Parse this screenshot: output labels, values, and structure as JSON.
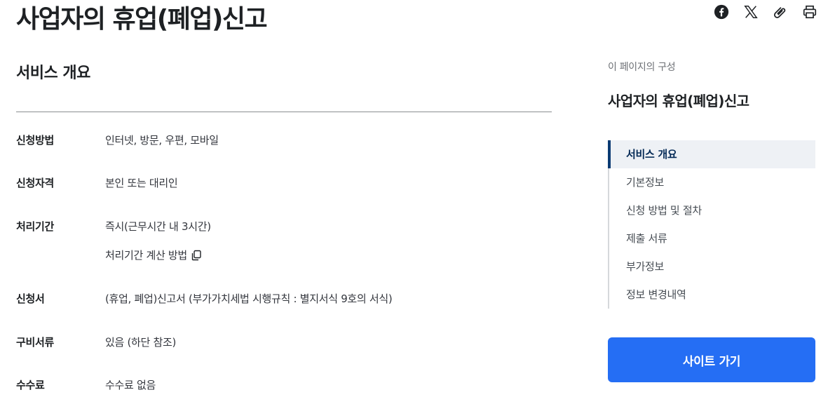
{
  "page": {
    "title": "사업자의 휴업(폐업)신고"
  },
  "share": {
    "icons": [
      "facebook-icon",
      "x-twitter-icon",
      "paperclip-icon",
      "printer-icon"
    ]
  },
  "overview": {
    "heading": "서비스 개요",
    "rows": [
      {
        "label": "신청방법",
        "value": "인터넷, 방문, 우편, 모바일"
      },
      {
        "label": "신청자격",
        "value": "본인 또는 대리인"
      },
      {
        "label": "처리기간",
        "value": "즉시(근무시간 내 3시간)",
        "link": "처리기간 계산 방법"
      },
      {
        "label": "신청서",
        "value": "(휴업, 폐업)신고서 (부가가치세법 시행규칙 : 별지서식 9호의 서식)"
      },
      {
        "label": "구비서류",
        "value": "있음 (하단 참조)"
      },
      {
        "label": "수수료",
        "value": "수수료 없음"
      }
    ]
  },
  "toc": {
    "caption": "이 페이지의 구성",
    "title": "사업자의 휴업(폐업)신고",
    "items": [
      {
        "label": "서비스 개요",
        "active": true
      },
      {
        "label": "기본정보"
      },
      {
        "label": "신청 방법 및 절차"
      },
      {
        "label": "제출 서류"
      },
      {
        "label": "부가정보"
      },
      {
        "label": "정보 변경내역"
      }
    ]
  },
  "cta": {
    "label": "사이트 가기"
  },
  "colors": {
    "primary_button": "#256ef4",
    "toc_active_bar": "#0b3b73",
    "toc_active_bg": "#eef1f5"
  }
}
